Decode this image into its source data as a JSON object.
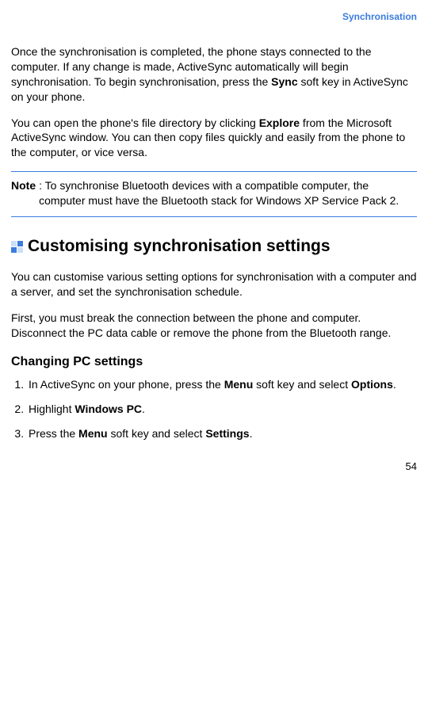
{
  "header": {
    "title": "Synchronisation"
  },
  "body": {
    "para1_pre": "Once the synchronisation is completed, the phone stays connected to the computer. If any change is made, ActiveSync automatically will begin synchronisation. To begin synchronisation, press the ",
    "para1_bold": "Sync",
    "para1_post": " soft key in ActiveSync on your phone.",
    "para2_pre": "You can open the phone's file directory by clicking ",
    "para2_bold": "Explore",
    "para2_post": " from the Microsoft ActiveSync window. You can then copy files quickly and easily from the phone to the computer, or vice versa.",
    "note_label": "Note",
    "note_text": ": To synchronise Bluetooth devices with a compatible computer, the computer must have the Bluetooth stack for Windows XP Service Pack 2.",
    "h2": "Customising synchronisation settings",
    "para3": "You can customise various setting options for synchronisation with a computer and a server, and set the synchronisation schedule.",
    "para4": "First, you must break the connection between the phone and computer. Disconnect the PC data cable or remove the phone from the Bluetooth range.",
    "h3": "Changing PC settings",
    "steps": {
      "s1_pre": "In ActiveSync on your phone, press the ",
      "s1_b1": "Menu",
      "s1_mid": " soft key and select ",
      "s1_b2": "Options",
      "s1_post": ".",
      "s2_pre": "Highlight ",
      "s2_b1": "Windows PC",
      "s2_post": ".",
      "s3_pre": "Press the ",
      "s3_b1": "Menu",
      "s3_mid": " soft key and select ",
      "s3_b2": "Settings",
      "s3_post": "."
    }
  },
  "page_number": "54"
}
